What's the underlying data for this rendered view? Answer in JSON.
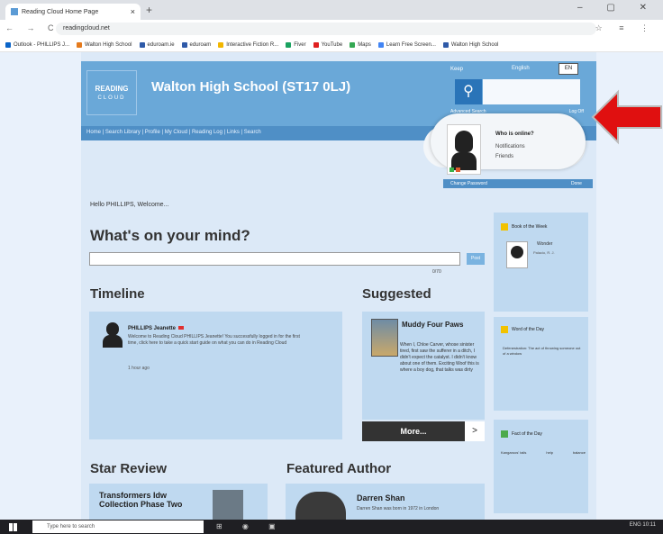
{
  "browser": {
    "tab_title": "Reading Cloud Home Page",
    "tab_close": "×",
    "new_tab": "+",
    "window_controls": "– ▢ ✕",
    "nav_buttons": "← → C",
    "url": "readingcloud.net",
    "addr_icons": "☆ ≡ ⋮",
    "bookmarks": [
      "Outlook - PHILLIPS J...",
      "Walton High School",
      "eduroam.ie",
      "eduroam",
      "Interactive Fiction R...",
      "Fiver",
      "YouTube",
      "Maps",
      "Learn Free Screen...",
      "Walton High School"
    ]
  },
  "header": {
    "logo_main": "READING",
    "logo_sub": "CLOUD",
    "school_title": "Walton High School (ST17 0LJ)",
    "nav_links": "Home  |  Search Library  |  Profile  |  My Cloud  |  Reading Log  |  Links  |  Search",
    "lang_label": "English",
    "lang_select": "EN",
    "search_label": "Keep",
    "search_icon": "⚲",
    "search_links_left": "Advanced Search",
    "search_links_right": "Log Off"
  },
  "popup": {
    "who": "Who is online?",
    "option1": "Notifications",
    "option2": "Friends",
    "change_password": "Change Password",
    "done": "Done"
  },
  "main": {
    "hello": "Hello PHILLIPS, Welcome...",
    "whats_on_mind": "What's on your mind?",
    "post_button": "Post",
    "counter": "0/70",
    "timeline_heading": "Timeline",
    "timeline_name": "PHILLIPS Jeanette",
    "timeline_text": "Welcome to Reading Cloud PHILLIPS Jeanette! You successfully logged in for the first time, click here to take a quick start guide on what you can do in Reading Cloud",
    "timeline_time": "1 hour ago",
    "suggested_heading": "Suggested",
    "suggested_title": "Muddy Four Paws",
    "suggested_text": "When I, Chloe Carver, whose sinister tired, first saw the sufferer in a ditch, I didn't expect the catalyst. I didn't know about one of them. Exciting Woof this is where a boy dog, that talks was dirty",
    "more_button": "More...",
    "more_next": ">",
    "star_review_heading": "Star Review",
    "star_review_title": "Transformers Idw Collection Phase Two",
    "featured_author_heading": "Featured Author",
    "featured_author_name": "Darren Shan",
    "featured_author_text": "Darren Shan was born in 1972 in London"
  },
  "sidebar": {
    "book_week": "Book of the Week",
    "book_week_author": "Wonder",
    "book_week_sub": "Palacio, R. J.",
    "word_day": "Word of the Day",
    "word_day_text": "Defenestration: The act of throwing someone out of a window",
    "fact_day": "Fact of the Day",
    "fact_day_left": "Kangaroos' tails",
    "fact_day_mid": "help",
    "fact_day_right": "balance"
  },
  "taskbar": {
    "search_placeholder": "Type here to search",
    "icons": "⊞ ◉ ▣",
    "tray": "ENG  10:11"
  },
  "colors": {
    "header_blue": "#6aa8d8",
    "panel_blue": "#bfd9f0",
    "arrow_red": "#e01010"
  }
}
